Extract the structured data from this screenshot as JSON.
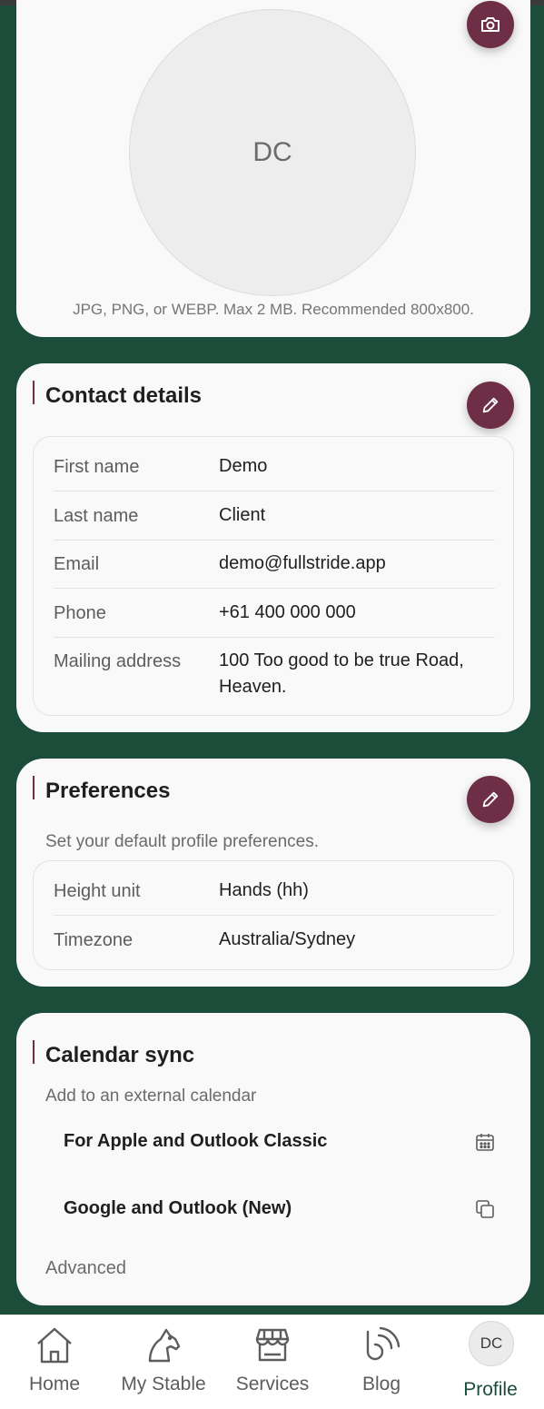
{
  "avatar_card": {
    "initials": "DC",
    "hint": "JPG, PNG, or WEBP. Max 2 MB. Recommended 800x800.",
    "upload_icon": "camera-icon"
  },
  "contact": {
    "title": "Contact details",
    "edit_icon": "pencil-icon",
    "rows": [
      {
        "label": "First name",
        "value": "Demo"
      },
      {
        "label": "Last name",
        "value": "Client"
      },
      {
        "label": "Email",
        "value": "demo@fullstride.app"
      },
      {
        "label": "Phone",
        "value": "+61 400 000 000"
      },
      {
        "label": "Mailing address",
        "value": "100 Too good to be true Road, Heaven."
      }
    ]
  },
  "preferences": {
    "title": "Preferences",
    "subtitle": "Set your default profile preferences.",
    "edit_icon": "pencil-icon",
    "rows": [
      {
        "label": "Height unit",
        "value": "Hands (hh)"
      },
      {
        "label": "Timezone",
        "value": "Australia/Sydney"
      }
    ]
  },
  "calendar": {
    "title": "Calendar sync",
    "subtitle": "Add to an external calendar",
    "items": [
      {
        "label": "For Apple and Outlook Classic",
        "icon": "calendar-icon"
      },
      {
        "label": "Google and Outlook (New)",
        "icon": "copy-icon"
      }
    ],
    "advanced": "Advanced"
  },
  "nav": {
    "items": [
      {
        "label": "Home",
        "icon": "home-icon"
      },
      {
        "label": "My Stable",
        "icon": "horse-icon"
      },
      {
        "label": "Services",
        "icon": "storefront-icon"
      },
      {
        "label": "Blog",
        "icon": "rss-icon"
      },
      {
        "label": "Profile",
        "icon": "avatar",
        "initials": "DC"
      }
    ],
    "active": "Profile"
  },
  "colors": {
    "background": "#1b4d3a",
    "accent": "#6d2e46",
    "card": "#f9f9f9"
  }
}
